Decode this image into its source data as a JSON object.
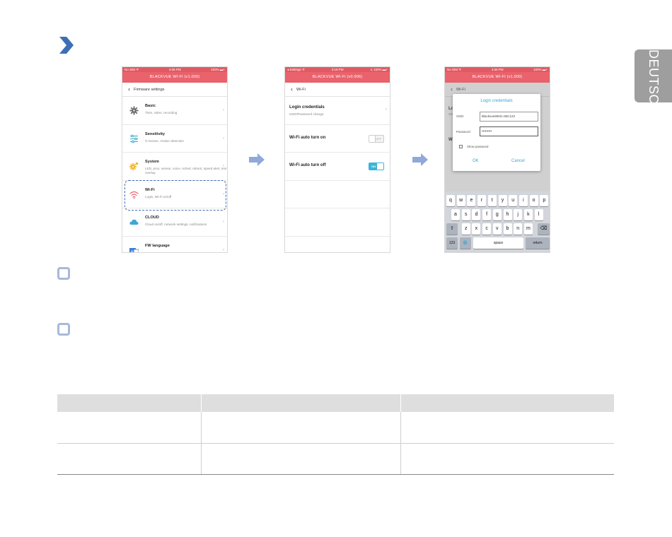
{
  "language_tab": "DEUTSCH",
  "colors": {
    "accent_red": "#e9626c",
    "accent_blue": "#3d6fb6",
    "toggle_on": "#3cb3d8",
    "step_arrow": "#8fa9da",
    "table_header": "#dedede"
  },
  "screen1": {
    "status": {
      "left": "No SIM ᯤ",
      "center": "4:06 PM",
      "right": "100% ▬+"
    },
    "title": "BLACKVUE WI-FI (v1.000)",
    "nav": "Firmware settings",
    "items": [
      {
        "title": "Basic",
        "sub": "Time, video, recording",
        "icon": "gear-icon"
      },
      {
        "title": "Sensitivity",
        "sub": "G-sensor, motion detection",
        "icon": "sliders-icon"
      },
      {
        "title": "System",
        "sub": "LED, prox. sensor, voice, sched. reboot, speed alert, text overlay",
        "icon": "system-gear-icon"
      },
      {
        "title": "Wi-Fi",
        "sub": "Login, Wi-Fi on/off",
        "icon": "wifi-icon"
      },
      {
        "title": "CLOUD",
        "sub": "Cloud on/off, network settings, notifications",
        "icon": "cloud-icon"
      },
      {
        "title": "FW language",
        "sub": "",
        "icon": "language-icon"
      }
    ]
  },
  "screen2": {
    "status": {
      "left": "◂ Settings ᯤ",
      "center": "3:19 PM",
      "right": "↳ 100% ▬+"
    },
    "title": "BLACKVUE WI-FI (v0.906)",
    "nav": "Wi-Fi",
    "rows": [
      {
        "title": "Login credentials",
        "sub": "SSID/Password change"
      },
      {
        "title": "Wi-Fi auto turn on",
        "toggle": "OFF"
      },
      {
        "title": "Wi-Fi auto turn off",
        "toggle": "ON"
      }
    ]
  },
  "screen3": {
    "status": {
      "left": "No SIM ᯤ",
      "center": "4:06 PM",
      "right": "100% ▬+"
    },
    "title": "BLACKVUE WI-FI (v1.000)",
    "nav": "Wi-Fi",
    "bg_peek": {
      "lo": "Lo",
      "ss": "SSI",
      "wi": "Wi"
    },
    "dialog": {
      "title": "Login credentials",
      "ssid_label": "SSID",
      "ssid_value": "Blackvue900S-ABC123",
      "password_label": "Password",
      "password_value": "•••••••••",
      "show_password": "Show password",
      "ok": "OK",
      "cancel": "Cancel"
    },
    "keyboard": {
      "row1": [
        "q",
        "w",
        "e",
        "r",
        "t",
        "y",
        "u",
        "i",
        "o",
        "p"
      ],
      "row2": [
        "a",
        "s",
        "d",
        "f",
        "g",
        "h",
        "j",
        "k",
        "l"
      ],
      "row3": [
        "z",
        "x",
        "c",
        "v",
        "b",
        "n",
        "m"
      ],
      "num": "123",
      "globe": "🌐",
      "space": "space",
      "return": "return",
      "shift": "⇧",
      "delete": "⌫"
    }
  },
  "table": {
    "columns": 3,
    "rows": 2
  }
}
